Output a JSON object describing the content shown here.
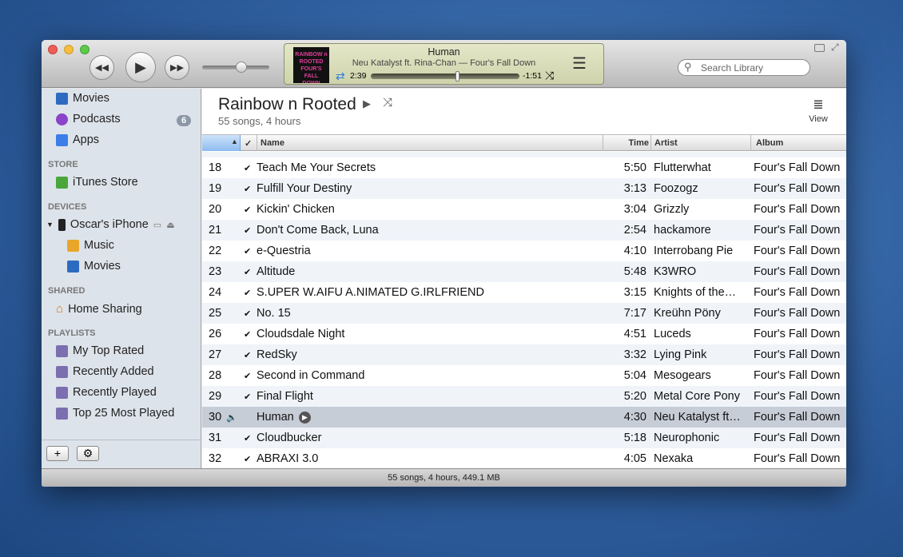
{
  "player": {
    "title": "Human",
    "subtitle": "Neu Katalyst ft. Rina-Chan — Four's Fall Down",
    "elapsed": "2:39",
    "remaining": "-1:51",
    "progress": 0.58,
    "volume": 0.6,
    "art_text": "RAINBOW n ROOTED FOUR'S FALL DOWN"
  },
  "search": {
    "placeholder": "Search Library"
  },
  "sidebar": {
    "library": [
      {
        "label": "Movies"
      },
      {
        "label": "Podcasts",
        "badge": "6"
      },
      {
        "label": "Apps"
      }
    ],
    "store_header": "STORE",
    "store": [
      {
        "label": "iTunes Store"
      }
    ],
    "devices_header": "DEVICES",
    "device": {
      "label": "Oscar's iPhone",
      "children": [
        {
          "label": "Music"
        },
        {
          "label": "Movies"
        }
      ]
    },
    "shared_header": "SHARED",
    "shared": [
      {
        "label": "Home Sharing"
      }
    ],
    "playlists_header": "PLAYLISTS",
    "playlists": [
      {
        "label": "My Top Rated"
      },
      {
        "label": "Recently Added"
      },
      {
        "label": "Recently Played"
      },
      {
        "label": "Top 25 Most Played"
      }
    ],
    "add_label": "+",
    "gear_label": "⚙"
  },
  "playlist": {
    "title": "Rainbow n Rooted",
    "summary": "55 songs, 4 hours",
    "view_label": "View"
  },
  "columns": {
    "check": "✓",
    "name": "Name",
    "time": "Time",
    "artist": "Artist",
    "album": "Album"
  },
  "rows": [
    {
      "n": "18",
      "name": "Teach Me Your Secrets",
      "time": "5:50",
      "artist": "Flutterwhat",
      "album": "Four's Fall Down"
    },
    {
      "n": "19",
      "name": "Fulfill Your Destiny",
      "time": "3:13",
      "artist": "Foozogz",
      "album": "Four's Fall Down"
    },
    {
      "n": "20",
      "name": "Kickin' Chicken",
      "time": "3:04",
      "artist": "Grizzly",
      "album": "Four's Fall Down"
    },
    {
      "n": "21",
      "name": "Don't Come Back, Luna",
      "time": "2:54",
      "artist": "hackamore",
      "album": "Four's Fall Down"
    },
    {
      "n": "22",
      "name": "e-Questria",
      "time": "4:10",
      "artist": "Interrobang Pie",
      "album": "Four's Fall Down"
    },
    {
      "n": "23",
      "name": "Altitude",
      "time": "5:48",
      "artist": "K3WRO",
      "album": "Four's Fall Down"
    },
    {
      "n": "24",
      "name": "S.UPER W.AIFU A.NIMATED G.IRLFRIEND",
      "time": "3:15",
      "artist": "Knights of the…",
      "album": "Four's Fall Down"
    },
    {
      "n": "25",
      "name": "No. 15",
      "time": "7:17",
      "artist": "Kreühn Pöny",
      "album": "Four's Fall Down"
    },
    {
      "n": "26",
      "name": "Cloudsdale Night",
      "time": "4:51",
      "artist": "Luceds",
      "album": "Four's Fall Down"
    },
    {
      "n": "27",
      "name": "RedSky",
      "time": "3:32",
      "artist": "Lying Pink",
      "album": "Four's Fall Down"
    },
    {
      "n": "28",
      "name": "Second in Command",
      "time": "5:04",
      "artist": "Mesogears",
      "album": "Four's Fall Down"
    },
    {
      "n": "29",
      "name": "Final Flight",
      "time": "5:20",
      "artist": "Metal Core Pony",
      "album": "Four's Fall Down"
    },
    {
      "n": "30",
      "name": "Human",
      "time": "4:30",
      "artist": "Neu Katalyst ft…",
      "album": "Four's Fall Down",
      "playing": true
    },
    {
      "n": "31",
      "name": "Cloudbucker",
      "time": "5:18",
      "artist": "Neurophonic",
      "album": "Four's Fall Down"
    },
    {
      "n": "32",
      "name": "ABRAXI 3.0",
      "time": "4:05",
      "artist": "Nexaka",
      "album": "Four's Fall Down"
    }
  ],
  "status": "55 songs, 4 hours, 449.1 MB",
  "colors": {
    "selected_row": "#c7cdd7",
    "alt_row": "#f0f4f9",
    "sidebar": "#dde3ea",
    "lcd": "#d9dcb9"
  }
}
